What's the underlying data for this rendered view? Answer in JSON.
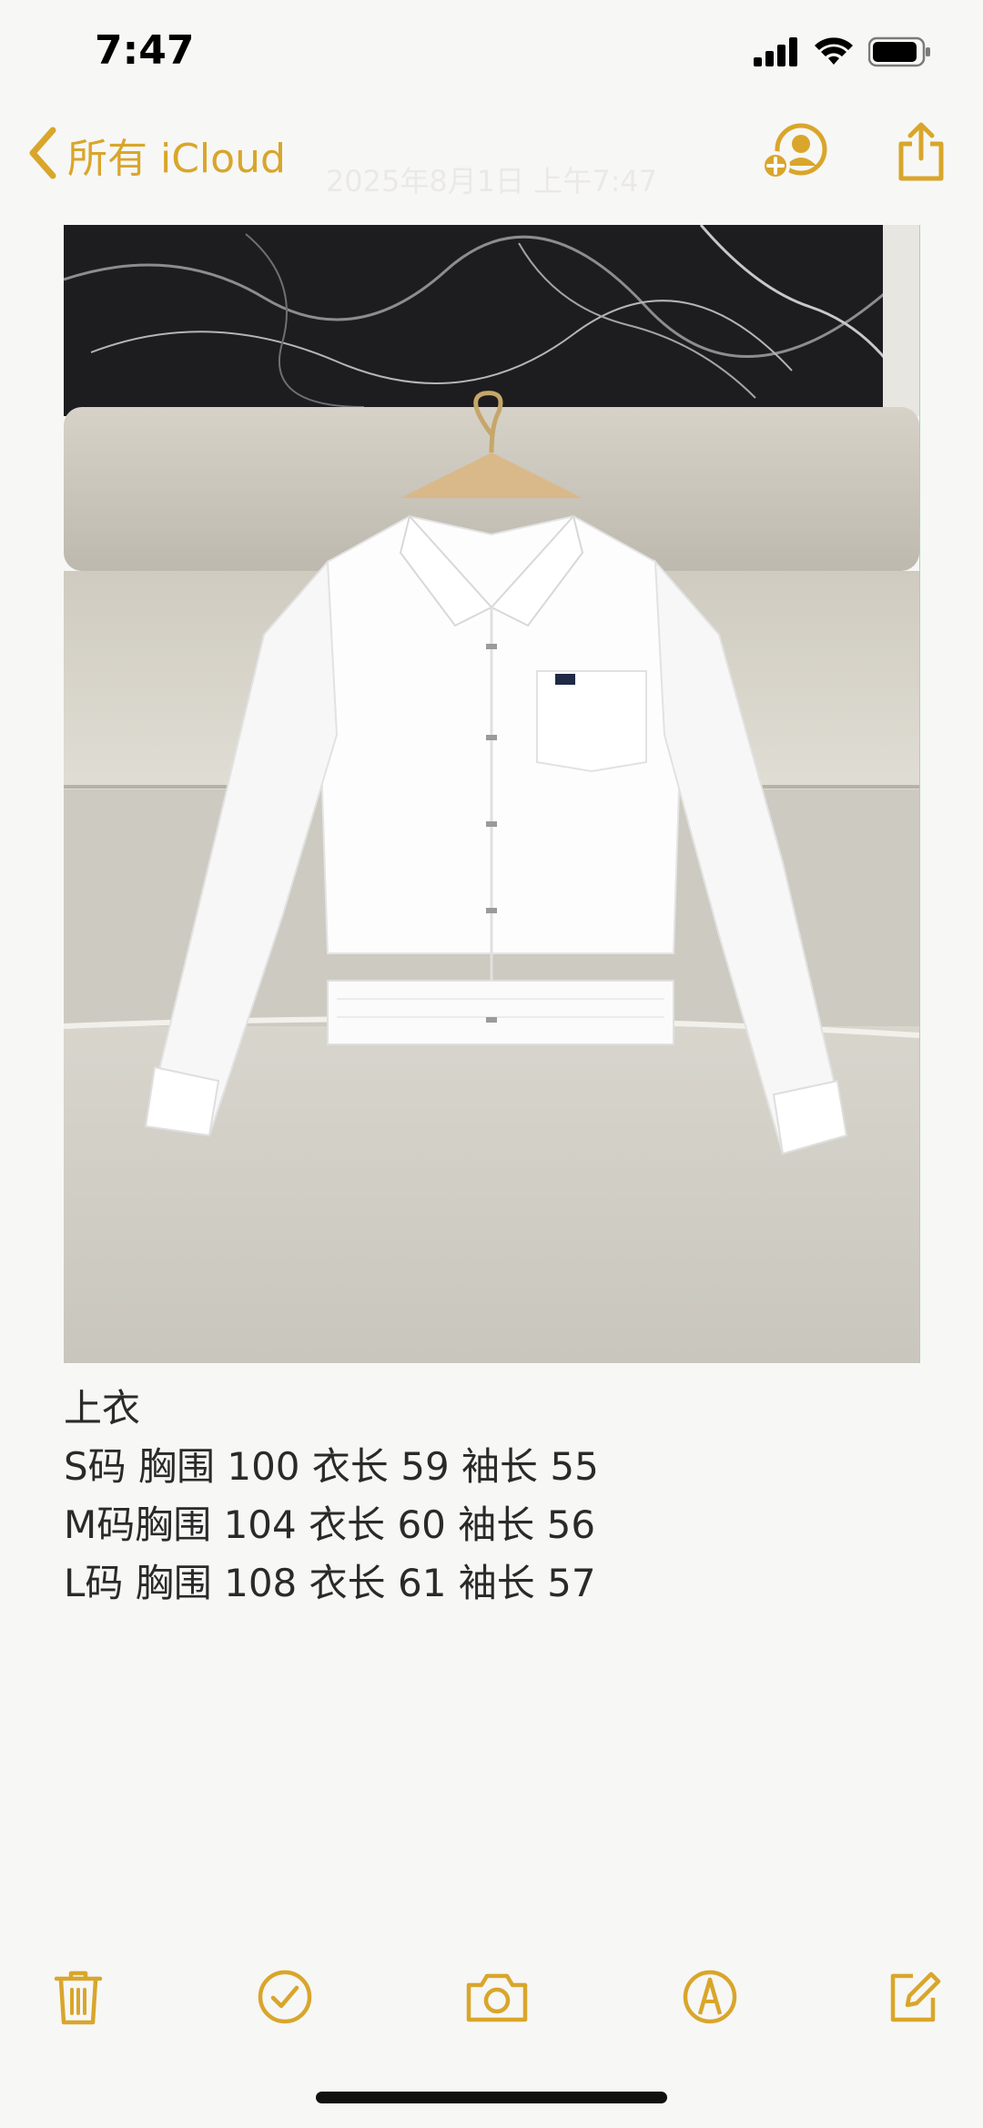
{
  "status_bar": {
    "time": "7:47",
    "icons": [
      "cellular-signal-icon",
      "wifi-icon",
      "battery-icon"
    ]
  },
  "nav": {
    "back_label": "所有 iCloud",
    "date_text": "2025年8月1日 上午7:47",
    "icons": [
      "chevron-left-icon",
      "share-contact-icon",
      "share-icon"
    ]
  },
  "note": {
    "image_alt_icon": "shirt-photo",
    "lines": [
      "上衣",
      "S码 胸围 100 衣长 59 袖长 55",
      "M码胸围 104 衣长 60 袖长 56",
      "L码 胸围 108 衣长 61 袖长 57"
    ]
  },
  "toolbar": {
    "icons": [
      "trash-icon",
      "checklist-icon",
      "camera-icon",
      "markup-icon",
      "compose-icon"
    ]
  },
  "colors": {
    "accent": "#d9a62b",
    "background": "#f7f7f6",
    "text": "#2a2a2a"
  }
}
